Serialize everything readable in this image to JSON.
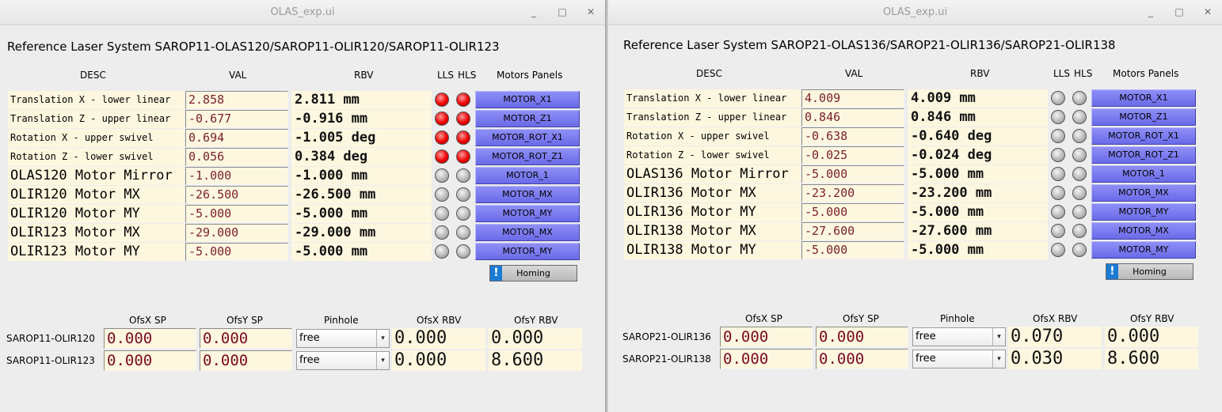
{
  "windows": [
    {
      "title": "OLAS_exp.ui",
      "heading": "Reference Laser System SAROP11-OLAS120/SAROP11-OLIR120/SAROP11-OLIR123",
      "headers": {
        "desc": "DESC",
        "val": "VAL",
        "rbv": "RBV",
        "lls": "LLS",
        "hls": "HLS",
        "motors": "Motors Panels"
      },
      "rows": [
        {
          "desc": "Translation X - lower linear",
          "val": "2.858",
          "rbv": "2.811 mm",
          "lls": "red",
          "hls": "red",
          "motor": "MOTOR_X1"
        },
        {
          "desc": "Translation Z - upper linear",
          "val": "-0.677",
          "rbv": "-0.916 mm",
          "lls": "red",
          "hls": "red",
          "motor": "MOTOR_Z1"
        },
        {
          "desc": "Rotation X - upper swivel",
          "val": "0.694",
          "rbv": "-1.005 deg",
          "lls": "red",
          "hls": "red",
          "motor": "MOTOR_ROT_X1"
        },
        {
          "desc": "Rotation Z - lower swivel",
          "val": "0.056",
          "rbv": "0.384 deg",
          "lls": "red",
          "hls": "red",
          "motor": "MOTOR_ROT_Z1"
        },
        {
          "desc": "OLAS120 Motor Mirror",
          "val": "-1.000",
          "rbv": "-1.000 mm",
          "lls": "off",
          "hls": "off",
          "motor": "MOTOR_1"
        },
        {
          "desc": "OLIR120 Motor MX",
          "val": "-26.500",
          "rbv": "-26.500 mm",
          "lls": "off",
          "hls": "off",
          "motor": "MOTOR_MX"
        },
        {
          "desc": "OLIR120 Motor MY",
          "val": "-5.000",
          "rbv": "-5.000 mm",
          "lls": "off",
          "hls": "off",
          "motor": "MOTOR_MY"
        },
        {
          "desc": "OLIR123 Motor MX",
          "val": "-29.000",
          "rbv": "-29.000 mm",
          "lls": "off",
          "hls": "off",
          "motor": "MOTOR_MX"
        },
        {
          "desc": "OLIR123 Motor MY",
          "val": "-5.000",
          "rbv": "-5.000 mm",
          "lls": "off",
          "hls": "off",
          "motor": "MOTOR_MY"
        }
      ],
      "homing": {
        "icon": "!",
        "label": "Homing"
      },
      "offset_headers": {
        "ofsx_sp": "OfsX SP",
        "ofsy_sp": "OfsY SP",
        "pinhole": "Pinhole",
        "ofsx_rbv": "OfsX RBV",
        "ofsy_rbv": "OfsY RBV"
      },
      "offsets": [
        {
          "name": "SAROP11-OLIR120",
          "ofsx_sp": "0.000",
          "ofsy_sp": "0.000",
          "pinhole": "free",
          "ofsx_rbv": "0.000",
          "ofsy_rbv": "0.000"
        },
        {
          "name": "SAROP11-OLIR123",
          "ofsx_sp": "0.000",
          "ofsy_sp": "0.000",
          "pinhole": "free",
          "ofsx_rbv": "0.000",
          "ofsy_rbv": "8.600"
        }
      ]
    },
    {
      "title": "OLAS_exp.ui",
      "heading": "Reference Laser System SAROP21-OLAS136/SAROP21-OLIR136/SAROP21-OLIR138",
      "headers": {
        "desc": "DESC",
        "val": "VAL",
        "rbv": "RBV",
        "lls": "LLS",
        "hls": "HLS",
        "motors": "Motors Panels"
      },
      "rows": [
        {
          "desc": "Translation X - lower linear",
          "val": "4.009",
          "rbv": "4.009 mm",
          "lls": "off",
          "hls": "off",
          "motor": "MOTOR_X1"
        },
        {
          "desc": "Translation Z - upper linear",
          "val": "0.846",
          "rbv": "0.846 mm",
          "lls": "off",
          "hls": "off",
          "motor": "MOTOR_Z1"
        },
        {
          "desc": "Rotation X - upper swivel",
          "val": "-0.638",
          "rbv": "-0.640 deg",
          "lls": "off",
          "hls": "off",
          "motor": "MOTOR_ROT_X1"
        },
        {
          "desc": "Rotation Z - lower swivel",
          "val": "-0.025",
          "rbv": "-0.024 deg",
          "lls": "off",
          "hls": "off",
          "motor": "MOTOR_ROT_Z1"
        },
        {
          "desc": "OLAS136 Motor Mirror",
          "val": "-5.000",
          "rbv": "-5.000 mm",
          "lls": "off",
          "hls": "off",
          "motor": "MOTOR_1"
        },
        {
          "desc": "OLIR136 Motor MX",
          "val": "-23.200",
          "rbv": "-23.200 mm",
          "lls": "off",
          "hls": "off",
          "motor": "MOTOR_MX"
        },
        {
          "desc": "OLIR136 Motor MY",
          "val": "-5.000",
          "rbv": "-5.000 mm",
          "lls": "off",
          "hls": "off",
          "motor": "MOTOR_MY"
        },
        {
          "desc": "OLIR138 Motor MX",
          "val": "-27.600",
          "rbv": "-27.600 mm",
          "lls": "off",
          "hls": "off",
          "motor": "MOTOR_MX"
        },
        {
          "desc": "OLIR138 Motor MY",
          "val": "-5.000",
          "rbv": "-5.000 mm",
          "lls": "off",
          "hls": "off",
          "motor": "MOTOR_MY"
        }
      ],
      "homing": {
        "icon": "!",
        "label": "Homing"
      },
      "offset_headers": {
        "ofsx_sp": "OfsX SP",
        "ofsy_sp": "OfsY SP",
        "pinhole": "Pinhole",
        "ofsx_rbv": "OfsX RBV",
        "ofsy_rbv": "OfsY RBV"
      },
      "offsets": [
        {
          "name": "SAROP21-OLIR136",
          "ofsx_sp": "0.000",
          "ofsy_sp": "0.000",
          "pinhole": "free",
          "ofsx_rbv": "0.070",
          "ofsy_rbv": "0.000"
        },
        {
          "name": "SAROP21-OLIR138",
          "ofsx_sp": "0.000",
          "ofsy_sp": "0.000",
          "pinhole": "free",
          "ofsx_rbv": "0.030",
          "ofsy_rbv": "8.600"
        }
      ]
    }
  ],
  "icons": {
    "minimize": "minimize-icon",
    "maximize": "maximize-icon",
    "close": "close-icon",
    "dropdown": "chevron-down-icon",
    "warning": "exclamation-icon"
  },
  "colors": {
    "led_red": "#f00000",
    "led_off": "#b4b4b4",
    "motor_button": "#7a7aef",
    "field_bg": "#fdf7df",
    "setpoint_text": "#7a1f2b",
    "homing_icon": "#1a7ad4"
  }
}
